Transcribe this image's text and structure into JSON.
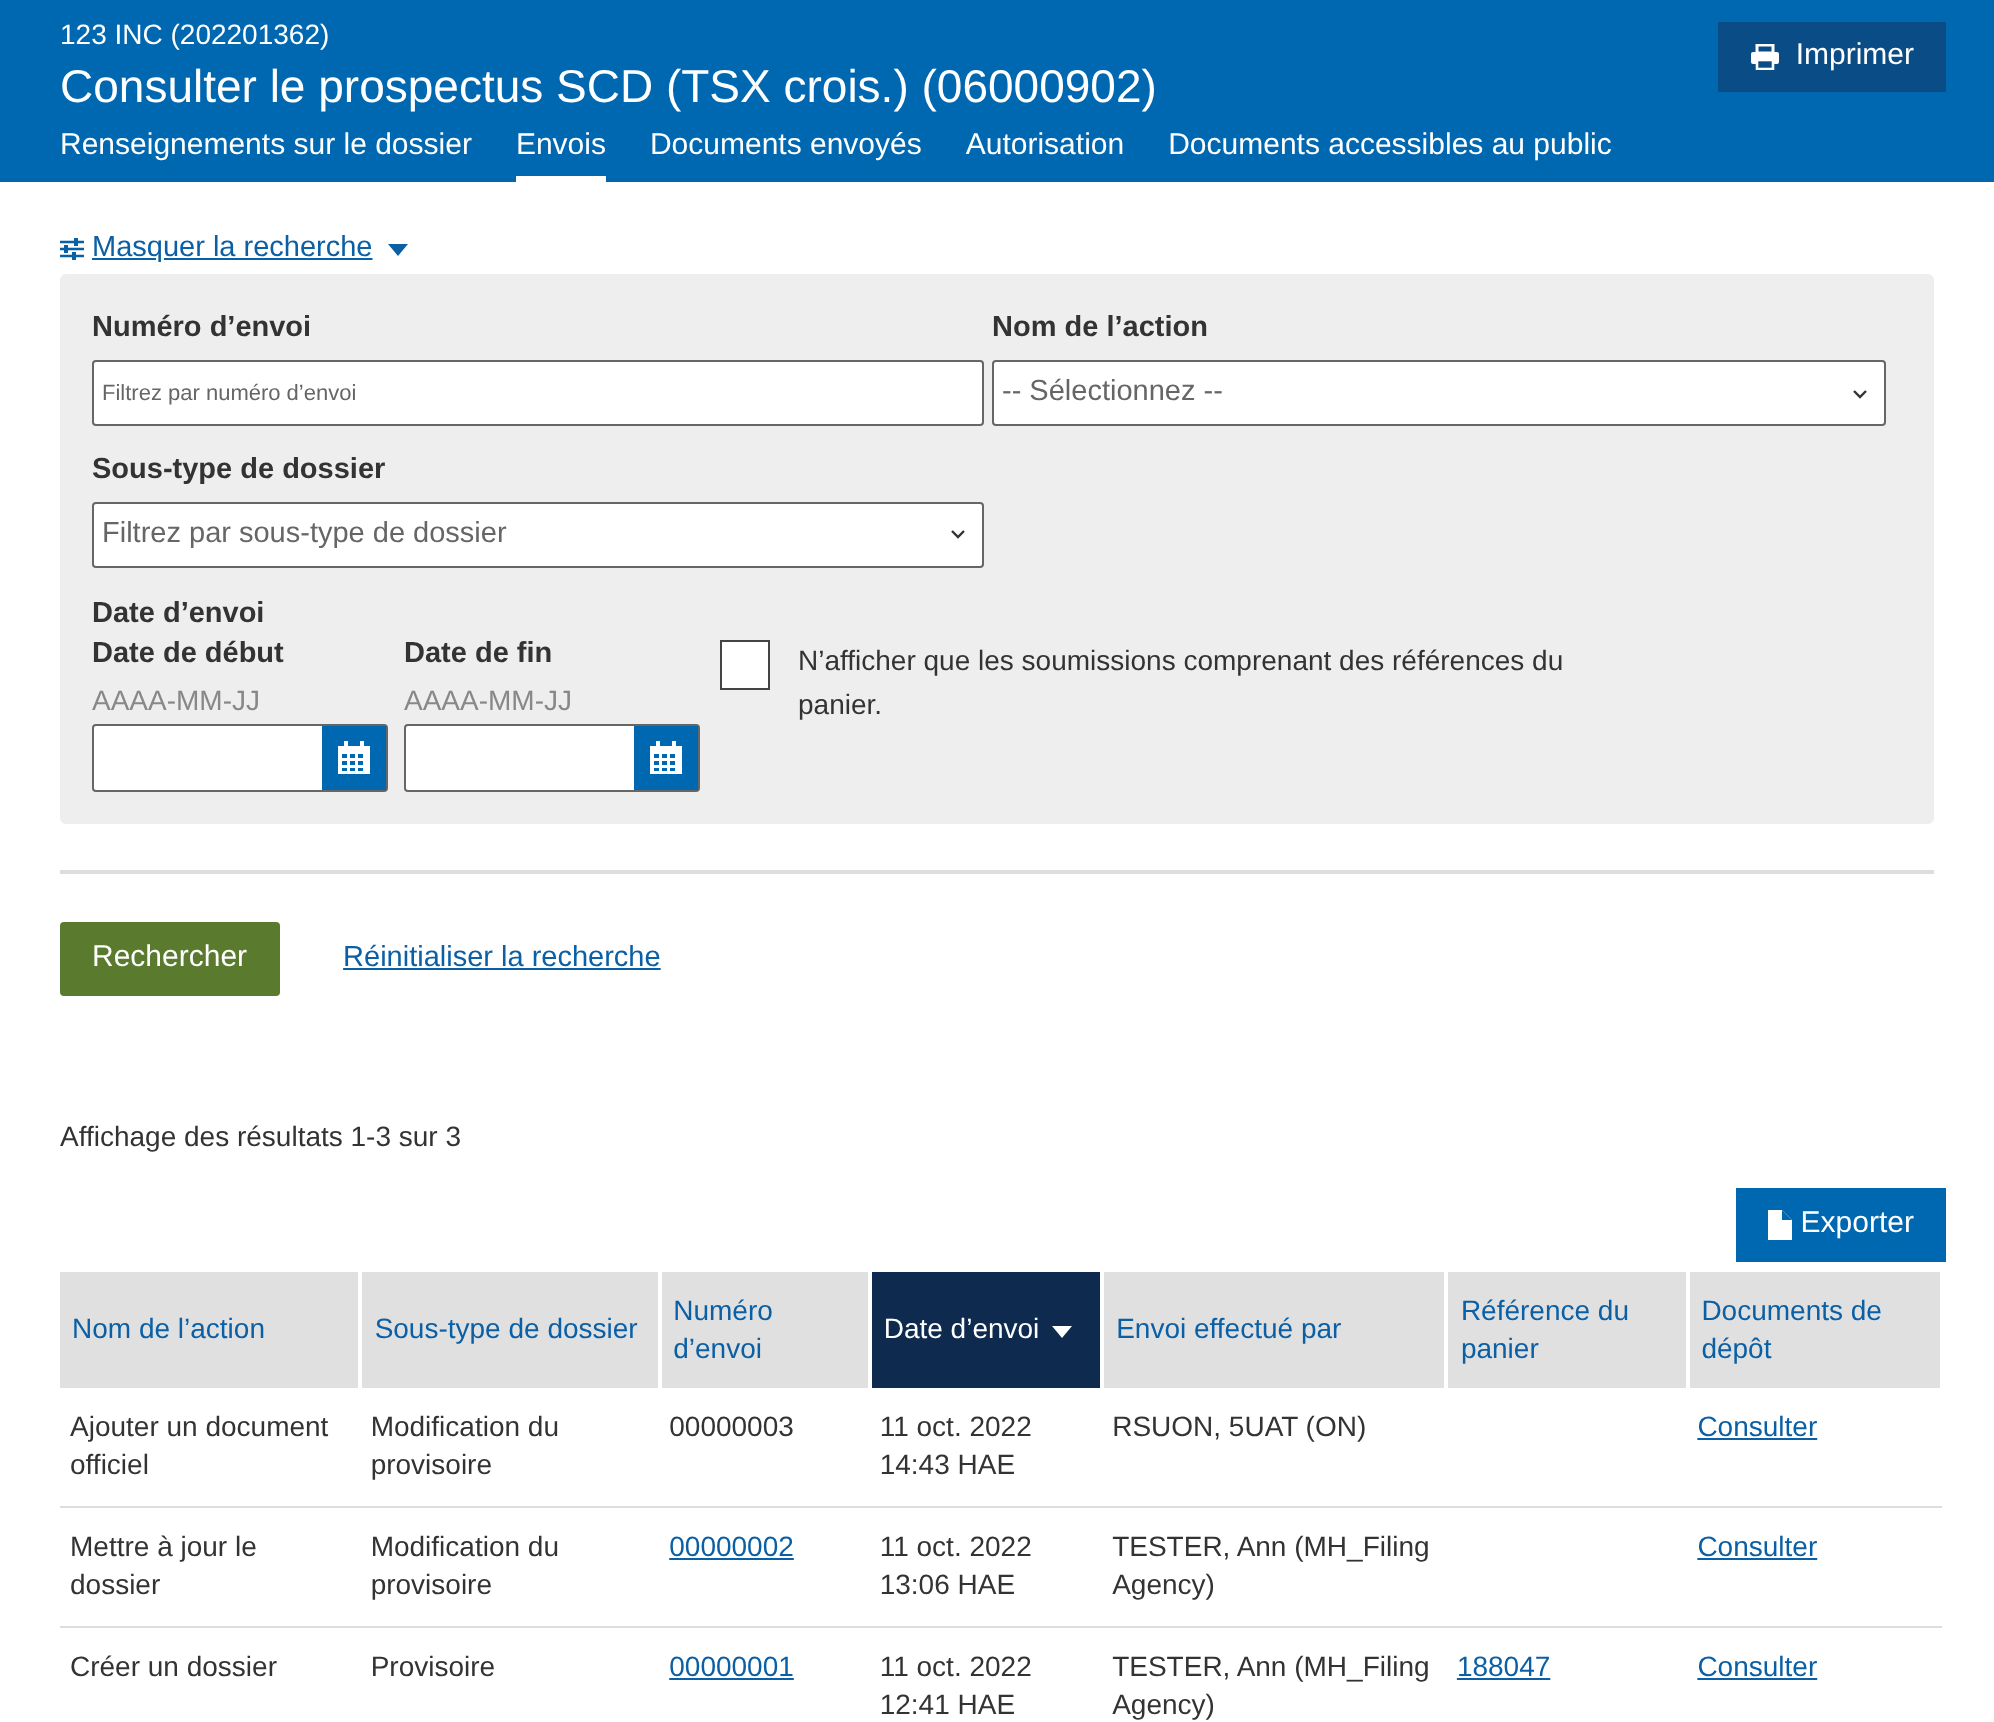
{
  "header": {
    "company": "123 INC (202201362)",
    "title": "Consulter le prospectus SCD (TSX crois.) (06000902)",
    "print_button": "Imprimer"
  },
  "tabs": [
    {
      "label": "Renseignements sur le dossier",
      "selected": false
    },
    {
      "label": "Envois",
      "selected": true
    },
    {
      "label": "Documents envoyés",
      "selected": false
    },
    {
      "label": "Autorisation",
      "selected": false
    },
    {
      "label": "Documents accessibles au public",
      "selected": false
    }
  ],
  "search_toggle": {
    "label": "Masquer la recherche",
    "expanded": true
  },
  "filters": {
    "number": {
      "label": "Numéro d’envoi",
      "placeholder": "Filtrez par numéro d’envoi"
    },
    "action": {
      "label": "Nom de l’action",
      "value": "-- Sélectionnez --"
    },
    "subtype": {
      "label": "Sous-type de dossier",
      "placeholder": "Filtrez par sous-type de dossier"
    },
    "date_group": "Date d’envoi",
    "start": {
      "label": "Date de début",
      "hint": "AAAA-MM-JJ"
    },
    "end": {
      "label": "Date de fin",
      "hint": "AAAA-MM-JJ"
    },
    "basket_only": {
      "label": "N’afficher que les soumissions comprenant des références du panier.",
      "checked": false
    }
  },
  "search_button": "Rechercher",
  "reset_link": "Réinitialiser la recherche",
  "results_count": "Affichage des résultats 1-3 sur 3",
  "export_button": "Exporter",
  "table": {
    "columns": [
      {
        "label": "Nom de l’action",
        "sorted": false
      },
      {
        "label": "Sous-type de dossier",
        "sorted": false
      },
      {
        "label": "Numéro d’envoi",
        "sorted": false
      },
      {
        "label": "Date d’envoi",
        "sorted": true
      },
      {
        "label": "Envoi effectué par",
        "sorted": false
      },
      {
        "label": "Référence du panier",
        "sorted": false
      },
      {
        "label": "Documents de dépôt",
        "sorted": false
      }
    ],
    "rows": [
      {
        "cells": [
          {
            "text": "Ajouter un document officiel",
            "link": false
          },
          {
            "text": "Modification du provisoire",
            "link": false
          },
          {
            "text": "00000003",
            "link": false
          },
          {
            "text": "11 oct. 2022 14:43 HAE",
            "link": false
          },
          {
            "text": "RSUON, 5UAT (ON)",
            "link": false
          },
          null,
          {
            "text": "Consulter",
            "link": true
          }
        ]
      },
      {
        "cells": [
          {
            "text": "Mettre à jour le dossier",
            "link": false
          },
          {
            "text": "Modification du provisoire",
            "link": false
          },
          {
            "text": "00000002",
            "link": true
          },
          {
            "text": "11 oct. 2022 13:06 HAE",
            "link": false
          },
          {
            "text": "TESTER, Ann (MH_Filing Agency)",
            "link": false
          },
          null,
          {
            "text": "Consulter",
            "link": true
          }
        ]
      },
      {
        "cells": [
          {
            "text": "Créer un dossier",
            "link": false
          },
          {
            "text": "Provisoire",
            "link": false
          },
          {
            "text": "00000001",
            "link": true
          },
          {
            "text": "11 oct. 2022 12:41 HAE",
            "link": false
          },
          {
            "text": "TESTER, Ann (MH_Filing Agency)",
            "link": false
          },
          {
            "text": "188047",
            "link": true
          },
          {
            "text": "Consulter",
            "link": true
          }
        ]
      }
    ]
  }
}
